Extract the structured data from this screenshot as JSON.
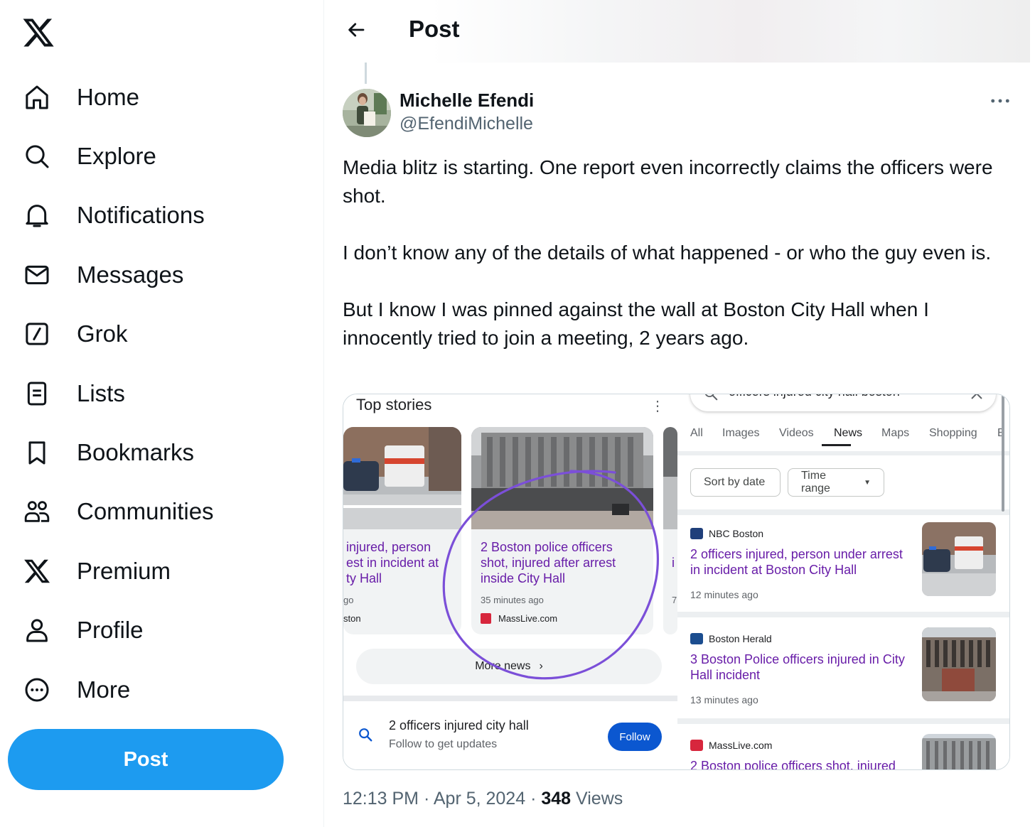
{
  "nav": {
    "items": [
      {
        "label": "Home",
        "icon": "home-icon"
      },
      {
        "label": "Explore",
        "icon": "search-icon"
      },
      {
        "label": "Notifications",
        "icon": "bell-icon"
      },
      {
        "label": "Messages",
        "icon": "envelope-icon"
      },
      {
        "label": "Grok",
        "icon": "grok-icon"
      },
      {
        "label": "Lists",
        "icon": "list-icon"
      },
      {
        "label": "Bookmarks",
        "icon": "bookmark-icon"
      },
      {
        "label": "Communities",
        "icon": "communities-icon"
      },
      {
        "label": "Premium",
        "icon": "x-premium-icon"
      },
      {
        "label": "Profile",
        "icon": "person-icon"
      },
      {
        "label": "More",
        "icon": "more-circle-icon"
      }
    ],
    "post_button": "Post"
  },
  "header": {
    "title": "Post"
  },
  "tweet": {
    "author_name": "Michelle Efendi",
    "author_handle": "@EfendiMichelle",
    "text": "Media blitz is starting. One report even incorrectly claims the officers were shot.\n\nI don’t know any of the details of what happened - or who the guy even is.\n\nBut I know I was pinned against the wall at Boston City Hall when I innocently tried to join a meeting, 2 years ago.",
    "time": "12:13 PM",
    "date": "Apr 5, 2024",
    "separator": " · ",
    "views_count": "348",
    "views_label": " Views"
  },
  "media": {
    "left": {
      "title": "Top stories",
      "card1": {
        "headline": "injured, person\nest in incident at\nty Hall",
        "time": "go",
        "source": "ston"
      },
      "card2": {
        "headline": "2 Boston police officers\nshot, injured after arrest\ninside City Hall",
        "time": "35 minutes ago",
        "source": "MassLive.com"
      },
      "card3": {
        "headline": "i",
        "time": "7"
      },
      "more_news": "More news",
      "follow": {
        "title": "2 officers injured city hall",
        "subtitle": "Follow to get updates",
        "button": "Follow"
      }
    },
    "right": {
      "query": "officers injured city hall boston",
      "tabs": [
        "All",
        "Images",
        "Videos",
        "News",
        "Maps",
        "Shopping",
        "B"
      ],
      "active_tab": "News",
      "chips": {
        "sort": "Sort by date",
        "time": "Time range"
      },
      "results": [
        {
          "publisher": "NBC Boston",
          "headline": "2 officers injured, person under arrest in incident at Boston City Hall",
          "time": "12 minutes ago"
        },
        {
          "publisher": "Boston Herald",
          "headline": "3 Boston Police officers injured in City Hall incident",
          "time": "13 minutes ago"
        },
        {
          "publisher": "MassLive.com",
          "headline": "2 Boston police officers shot, injured"
        }
      ]
    },
    "annotation_color": "#7b4fd8"
  },
  "colors": {
    "accent": "#1d9bf0",
    "text": "#0f1419",
    "secondary": "#536471",
    "google_link_visited": "#681da8",
    "google_blue": "#0b57d0"
  }
}
